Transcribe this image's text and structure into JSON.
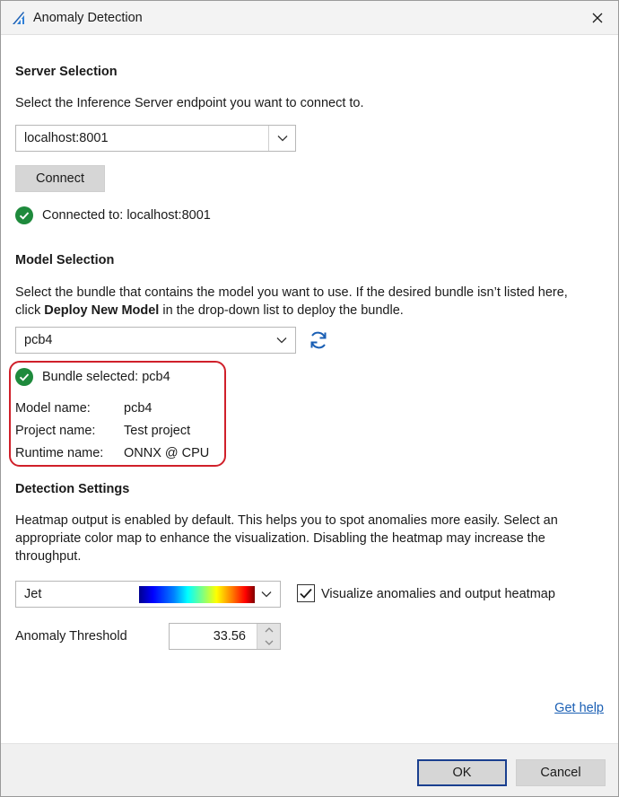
{
  "window": {
    "title": "Anomaly Detection"
  },
  "server": {
    "heading": "Server Selection",
    "description": "Select the Inference Server endpoint you want to connect to.",
    "endpoint_value": "localhost:8001",
    "connect_label": "Connect",
    "status_text": "Connected to: localhost:8001"
  },
  "model": {
    "heading": "Model Selection",
    "description_line1": "Select the bundle that contains the model you want to use. If the desired bundle isn’t listed here,",
    "description_line2_pre": "click ",
    "description_line2_bold": "Deploy New Model",
    "description_line2_post": " in the drop-down list to deploy the bundle.",
    "bundle_value": "pcb4",
    "status_text": "Bundle selected: pcb4",
    "details": [
      {
        "label": "Model name:",
        "value": "pcb4"
      },
      {
        "label": "Project name:",
        "value": "Test project"
      },
      {
        "label": "Runtime name:",
        "value": "ONNX @ CPU"
      }
    ]
  },
  "detection": {
    "heading": "Detection Settings",
    "description_line1": "Heatmap output is enabled by default. This helps you to spot anomalies more easily. Select an",
    "description_line2": "appropriate color map to enhance the visualization. Disabling the heatmap may increase the",
    "description_line3": "throughput.",
    "colormap_value": "Jet",
    "visualize_label": "Visualize anomalies and output heatmap",
    "visualize_checked": true,
    "threshold_label": "Anomaly Threshold",
    "threshold_value": "33.56"
  },
  "help_link": "Get help",
  "footer": {
    "ok_label": "OK",
    "cancel_label": "Cancel"
  },
  "colors": {
    "success_green": "#1e8a3c",
    "accent_blue": "#1a5fb4",
    "highlight_red": "#d0202a"
  }
}
